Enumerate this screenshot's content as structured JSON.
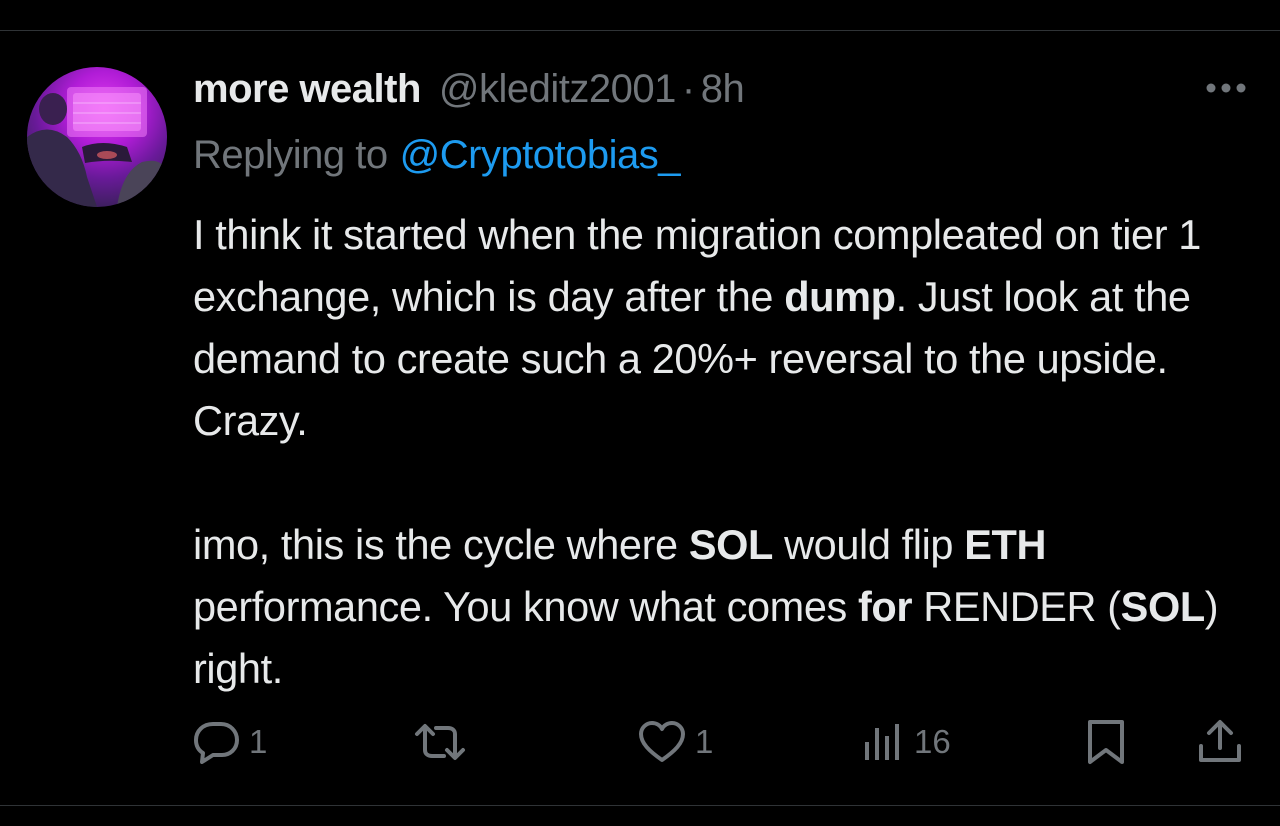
{
  "colors": {
    "background": "#000000",
    "text_primary": "#e7e9ea",
    "text_secondary": "#71767b",
    "link": "#1d9bf0",
    "divider": "#2f3336"
  },
  "tweet": {
    "display_name": "more wealth",
    "handle": "@kleditz2001",
    "separator": "·",
    "time": "8h",
    "reply_prefix": "Replying to",
    "reply_to": "@Cryptotobias_",
    "body": {
      "p1_a": "I think it started when the migration compleated on tier 1 exchange, which is day after the ",
      "p1_b": "dump",
      "p1_c": ". Just look at the demand to create such a 20%+ reversal to the upside. Crazy.",
      "p2_a": "imo, this is the cycle where ",
      "p2_b": "SOL",
      "p2_c": " would flip ",
      "p2_d": "ETH",
      "p2_e": " performance. You know what comes ",
      "p2_f": "for",
      "p2_g": " RENDER (",
      "p2_h": "SOL",
      "p2_i": ") right."
    }
  },
  "actions": {
    "reply": {
      "icon": "reply-icon",
      "count": "1"
    },
    "repost": {
      "icon": "repost-icon"
    },
    "like": {
      "icon": "heart-icon",
      "count": "1"
    },
    "views": {
      "icon": "views-icon",
      "count": "16"
    },
    "bookmark": {
      "icon": "bookmark-icon"
    },
    "share": {
      "icon": "share-icon"
    }
  }
}
